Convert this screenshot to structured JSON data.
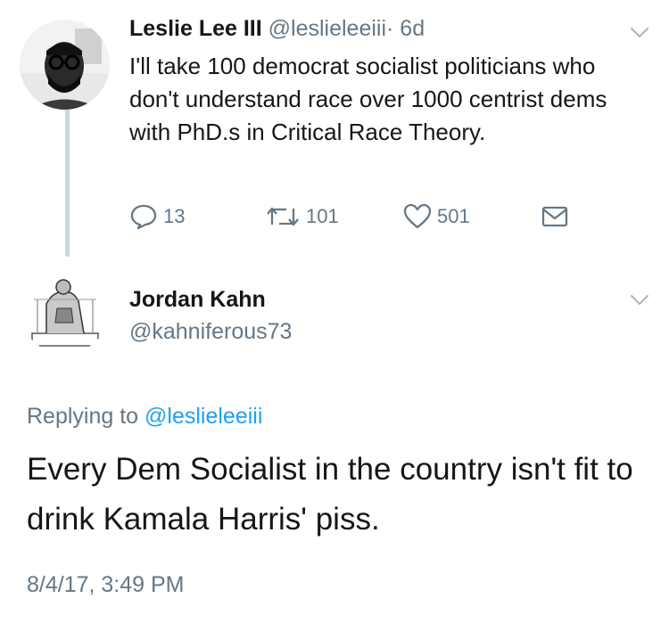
{
  "parent_tweet": {
    "author_name": "Leslie Lee III",
    "author_handle": "@leslieleeiii",
    "separator": "·",
    "age": "6d",
    "text": "I'll take 100 democrat socialist politicians who don't understand race over 1000 centrist dems with PhD.s in Critical Race Theory.",
    "reply_count": "13",
    "retweet_count": "101",
    "like_count": "501"
  },
  "reply_tweet": {
    "author_name": "Jordan Kahn",
    "author_handle": "@kahniferous73",
    "replying_to_prefix": "Replying to",
    "replying_to_handle": "@leslieleeiii",
    "text": "Every Dem Socialist in the country isn't fit to drink Kamala Harris' piss.",
    "timestamp": "8/4/17, 3:49 PM"
  },
  "icons": {
    "reply": "reply-icon",
    "retweet": "retweet-icon",
    "like": "heart-icon",
    "dm": "envelope-icon",
    "caret": "chevron-down-icon"
  },
  "colors": {
    "text": "#14171a",
    "muted": "#657786",
    "link": "#1da1f2",
    "thread_line": "#ccd6dd"
  }
}
